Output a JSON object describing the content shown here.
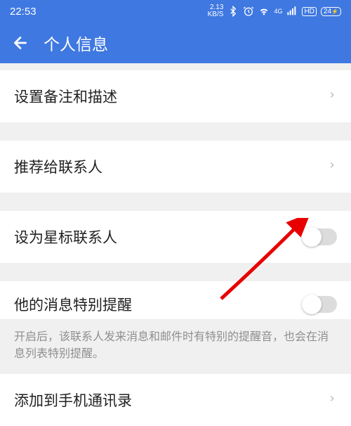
{
  "status_bar": {
    "time": "22:53",
    "net_speed_top": "2.13",
    "net_speed_bottom": "KB/S",
    "battery": "24"
  },
  "header": {
    "title": "个人信息"
  },
  "items": {
    "remark": "设置备注和描述",
    "recommend": "推荐给联系人",
    "star": "设为星标联系人",
    "notify": "他的消息特别提醒",
    "notify_desc": "开启后，该联系人发来消息和邮件时有特别的提醒音，也会在消息列表特别提醒。",
    "add_phone": "添加到手机通讯录"
  }
}
